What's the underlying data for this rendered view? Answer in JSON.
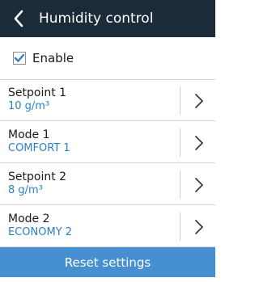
{
  "header": {
    "title": "Humidity control",
    "back_icon": "chevron-left-icon"
  },
  "enable": {
    "label": "Enable",
    "checked": true
  },
  "items": [
    {
      "label": "Setpoint 1",
      "value": "10 g/m³"
    },
    {
      "label": "Mode 1",
      "value": "COMFORT 1"
    },
    {
      "label": "Setpoint 2",
      "value": "8 g/m³"
    },
    {
      "label": "Mode 2",
      "value": "ECONOMY 2"
    }
  ],
  "reset_label": "Reset settings",
  "colors": {
    "header_bg": "#1c2b39",
    "value_text": "#2a7fc6",
    "reset_bg": "#4690d1",
    "check_mark": "#2a7fc6"
  }
}
